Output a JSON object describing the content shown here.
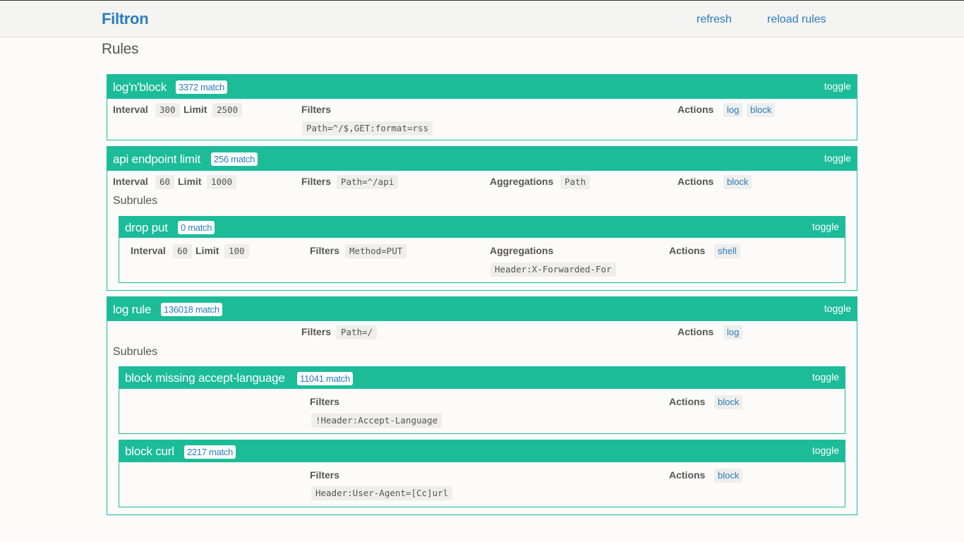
{
  "app": {
    "brand": "Filtron",
    "refresh": "refresh",
    "reload": "reload rules"
  },
  "page": {
    "title": "Rules"
  },
  "labels": {
    "interval": "Interval",
    "limit": "Limit",
    "filters": "Filters",
    "aggregations": "Aggregations",
    "actions": "Actions",
    "subrules": "Subrules",
    "toggle": "toggle"
  },
  "rules": [
    {
      "name": "log'n'block",
      "match": "3372 match",
      "interval": "300",
      "limit": "2500",
      "filters": [
        "Path=^/$,GET:format=rss"
      ],
      "actions": [
        "log",
        "block"
      ]
    },
    {
      "name": "api endpoint limit",
      "match": "256 match",
      "interval": "60",
      "limit": "1000",
      "filters": [
        "Path=^/api"
      ],
      "aggregations": [
        "Path"
      ],
      "actions": [
        "block"
      ],
      "subrules": [
        {
          "name": "drop put",
          "match": "0 match",
          "interval": "60",
          "limit": "100",
          "filters": [
            "Method=PUT"
          ],
          "aggregations": [
            "Header:X-Forwarded-For"
          ],
          "actions": [
            "shell"
          ]
        }
      ]
    },
    {
      "name": "log rule",
      "match": "136018 match",
      "filters": [
        "Path=/"
      ],
      "actions": [
        "log"
      ],
      "subrules": [
        {
          "name": "block missing accept-language",
          "match": "11041 match",
          "filters": [
            "!Header:Accept-Language"
          ],
          "actions": [
            "block"
          ]
        },
        {
          "name": "block curl",
          "match": "2217 match",
          "filters": [
            "Header:User-Agent=[Cc]url"
          ],
          "actions": [
            "block"
          ]
        }
      ]
    }
  ]
}
